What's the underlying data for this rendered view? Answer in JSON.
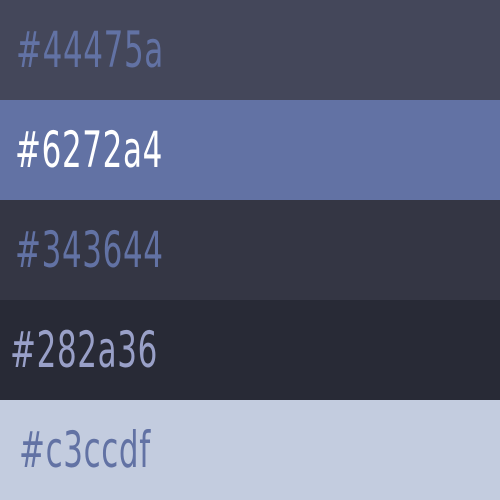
{
  "swatches": [
    {
      "hex_label": "#44475a",
      "background": "#44475a",
      "text_color": "#6272a4"
    },
    {
      "hex_label": "#6272a4",
      "background": "#6272a4",
      "text_color": "#ffffff"
    },
    {
      "hex_label": "#343644",
      "background": "#343644",
      "text_color": "#6272a4"
    },
    {
      "hex_label": "#282a36",
      "background": "#282a36",
      "text_color": "#99a0c8"
    },
    {
      "hex_label": "#c3ccdf",
      "background": "#c3ccdf",
      "text_color": "#6272a4"
    }
  ]
}
